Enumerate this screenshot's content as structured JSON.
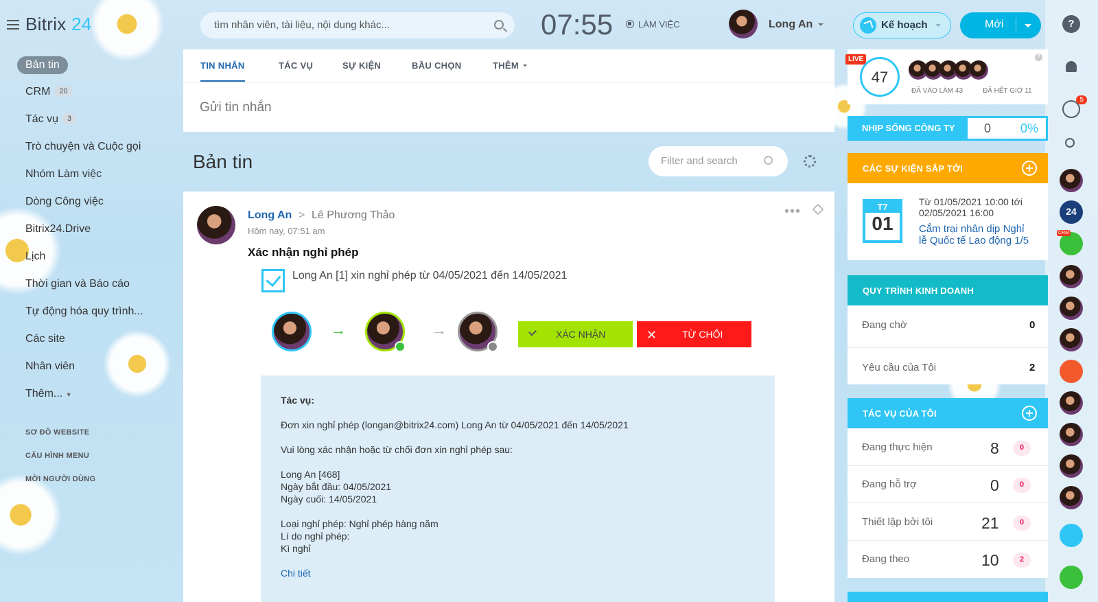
{
  "brand": {
    "name": "Bitrix",
    "num": "24"
  },
  "sidebar": {
    "items": [
      {
        "label": "Bản tin"
      },
      {
        "label": "CRM",
        "count": "20"
      },
      {
        "label": "Tác vụ",
        "count": "3"
      },
      {
        "label": "Trò chuyện và Cuộc gọi"
      },
      {
        "label": "Nhóm Làm việc"
      },
      {
        "label": "Dòng Công việc"
      },
      {
        "label": "Bitrix24.Drive"
      },
      {
        "label": "Lịch"
      },
      {
        "label": "Thời gian và Báo cáo"
      },
      {
        "label": "Tự động hóa quy trình..."
      },
      {
        "label": "Các site"
      },
      {
        "label": "Nhân viên"
      },
      {
        "label": "Thêm..."
      }
    ],
    "links": [
      "SƠ ĐỒ WEBSITE",
      "CẤU HÌNH MENU",
      "MỜI NGƯỜI DÙNG"
    ]
  },
  "header": {
    "search_placeholder": "tìm nhân viên, tài liệu, nội dung khác...",
    "clock": "07:55",
    "work_status": "LÀM VIỆC",
    "user_name": "Long An",
    "plan_label": "Kế hoạch",
    "new_label": "Mới"
  },
  "composer": {
    "tabs": [
      "TIN NHẮN",
      "TÁC VỤ",
      "SỰ KIỆN",
      "BẦU CHỌN",
      "THÊM"
    ],
    "send_placeholder": "Gửi tin nhắn"
  },
  "feed": {
    "title": "Bản tin",
    "filter_placeholder": "Filter and search"
  },
  "post": {
    "author": "Long An",
    "separator": ">",
    "recipient": "Lê Phương Thảo",
    "time": "Hôm nay, 07:51 am",
    "title": "Xác nhận nghỉ phép",
    "request": "Long An [1] xin nghỉ phép từ 04/05/2021 đến 14/05/2021",
    "flow_arrow": "→",
    "approve_label": "XÁC NHẬN",
    "reject_label": "TỪ CHỐI",
    "details": {
      "heading": "Tác vụ:",
      "line1": "Đơn xin nghỉ phép (longan@bitrix24.com) Long An từ 04/05/2021 đến 14/05/2021",
      "line2": "Vui lòng xác nhận hoặc từ chối đơn xin nghỉ phép sau:",
      "line3": "Long An [468]",
      "line4": "Ngày bắt đầu: 04/05/2021",
      "line5": "Ngày cuối: 14/05/2021",
      "line6": "Loại nghỉ phép: Nghỉ phép hàng năm",
      "line7": "Lí do nghỉ phép:",
      "line8": "Kì nghỉ",
      "link": "Chi tiết"
    }
  },
  "right": {
    "live": {
      "badge": "LIVE",
      "count": "47",
      "in_label": "ĐÃ VÀO LÀM",
      "in_count": "43",
      "out_label": "ĐÃ HẾT GIỜ",
      "out_count": "11"
    },
    "pulse": {
      "label": "NHỊP SỐNG CÔNG TY",
      "value": "0",
      "pct": "0%"
    },
    "events": {
      "title": "CÁC SỰ KIỆN SẮP TỚI",
      "day": "T7",
      "date": "01",
      "time_line1": "Từ 01/05/2021 10:00 tới",
      "time_line2": "02/05/2021 16:00",
      "name_line1": "Cắm trại nhân dịp Nghỉ",
      "name_line2": "lễ Quốc tế Lao động 1/5"
    },
    "process": {
      "title": "QUY TRÌNH KINH DOANH",
      "rows": [
        {
          "label": "Đang chờ",
          "value": "0"
        },
        {
          "label": "Yêu cầu của Tôi",
          "value": "2"
        }
      ]
    },
    "tasks": {
      "title": "TÁC VỤ CỦA TÔI",
      "rows": [
        {
          "label": "Đang thực hiện",
          "value": "8",
          "badge": "0"
        },
        {
          "label": "Đang hỗ trợ",
          "value": "0",
          "badge": "0"
        },
        {
          "label": "Thiết lập bởi tôi",
          "value": "21",
          "badge": "0"
        },
        {
          "label": "Đang theo",
          "value": "10",
          "badge": "2"
        }
      ]
    }
  },
  "strip": {
    "help": "?",
    "chat_badge": "5",
    "b24": "24",
    "crm": "CRM"
  },
  "colors": {
    "accent": "#2fc6f6",
    "orange": "#ffa900",
    "teal": "#13bbc9",
    "approve": "#a3e302",
    "reject": "#ff1a1a"
  }
}
